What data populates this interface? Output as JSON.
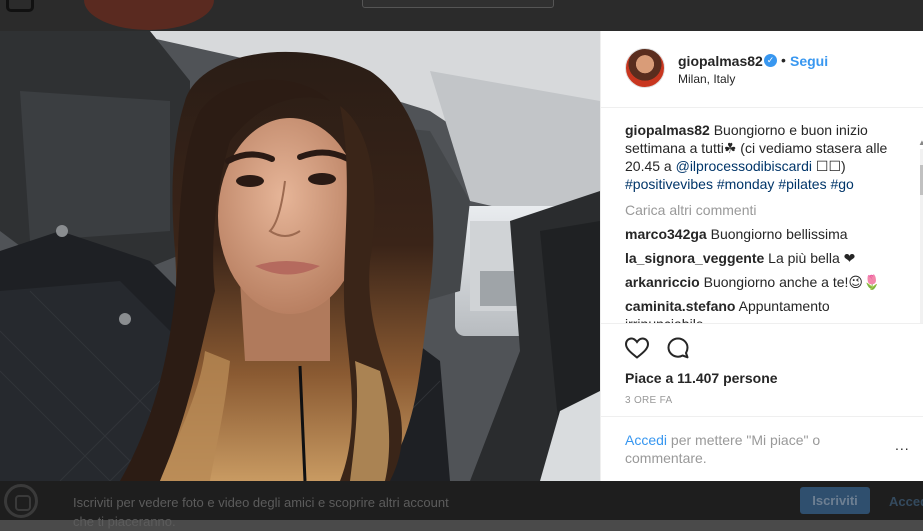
{
  "post": {
    "username": "giopalmas82",
    "verified_icon": "verified-badge-icon",
    "separator": "•",
    "follow_label": "Segui",
    "location": "Milan, Italy"
  },
  "caption": {
    "user": "giopalmas82",
    "text_before": "Buongiorno e buon inizio settimana a tutti",
    "emoji_clover": "☘",
    "text_middle": "(ci vediamo stasera alle 20.45 a",
    "mention": "@ilprocessodibiscardi",
    "boxes": "☐☐)",
    "hashtags": [
      "#positivevibes",
      "#monday",
      "#pilates",
      "#go"
    ]
  },
  "load_more_label": "Carica altri commenti",
  "comments": [
    {
      "user": "marco342ga",
      "text": "Buongiorno bellissima"
    },
    {
      "user": "la_signora_veggente",
      "text": "La più bella ❤"
    },
    {
      "user": "arkanriccio",
      "text": "Buongiorno anche a te!😉🌷"
    },
    {
      "user": "caminita.stefano",
      "text": "Appuntamento irrinunciabile"
    }
  ],
  "actions": {
    "likes": "Piace a 11.407 persone",
    "time": "3 ORE FA",
    "login_link": "Accedi",
    "login_rest": "per mettere \"Mi piace\" o commentare.",
    "more_label": "..."
  },
  "background": {
    "signup_text": "Iscriviti per vedere foto e video degli amici e scoprire altri account che ti piaceranno.",
    "signup_button": "Iscriviti",
    "login_link": "Accedi"
  },
  "colors": {
    "accent": "#3897f0",
    "text": "#262626",
    "muted": "#999999",
    "link_dark": "#003569"
  }
}
